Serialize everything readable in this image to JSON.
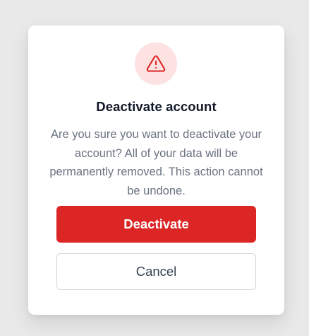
{
  "dialog": {
    "icon": "warning-triangle-icon",
    "title": "Deactivate account",
    "message": "Are you sure you want to deactivate your account? All of your data will be permanently removed. This action cannot be undone.",
    "confirm_label": "Deactivate",
    "cancel_label": "Cancel"
  },
  "colors": {
    "danger": "#dc2626",
    "icon_bg": "#fde2e2",
    "title": "#111827",
    "message": "#6b7280",
    "backdrop": "#e9e9ea"
  }
}
